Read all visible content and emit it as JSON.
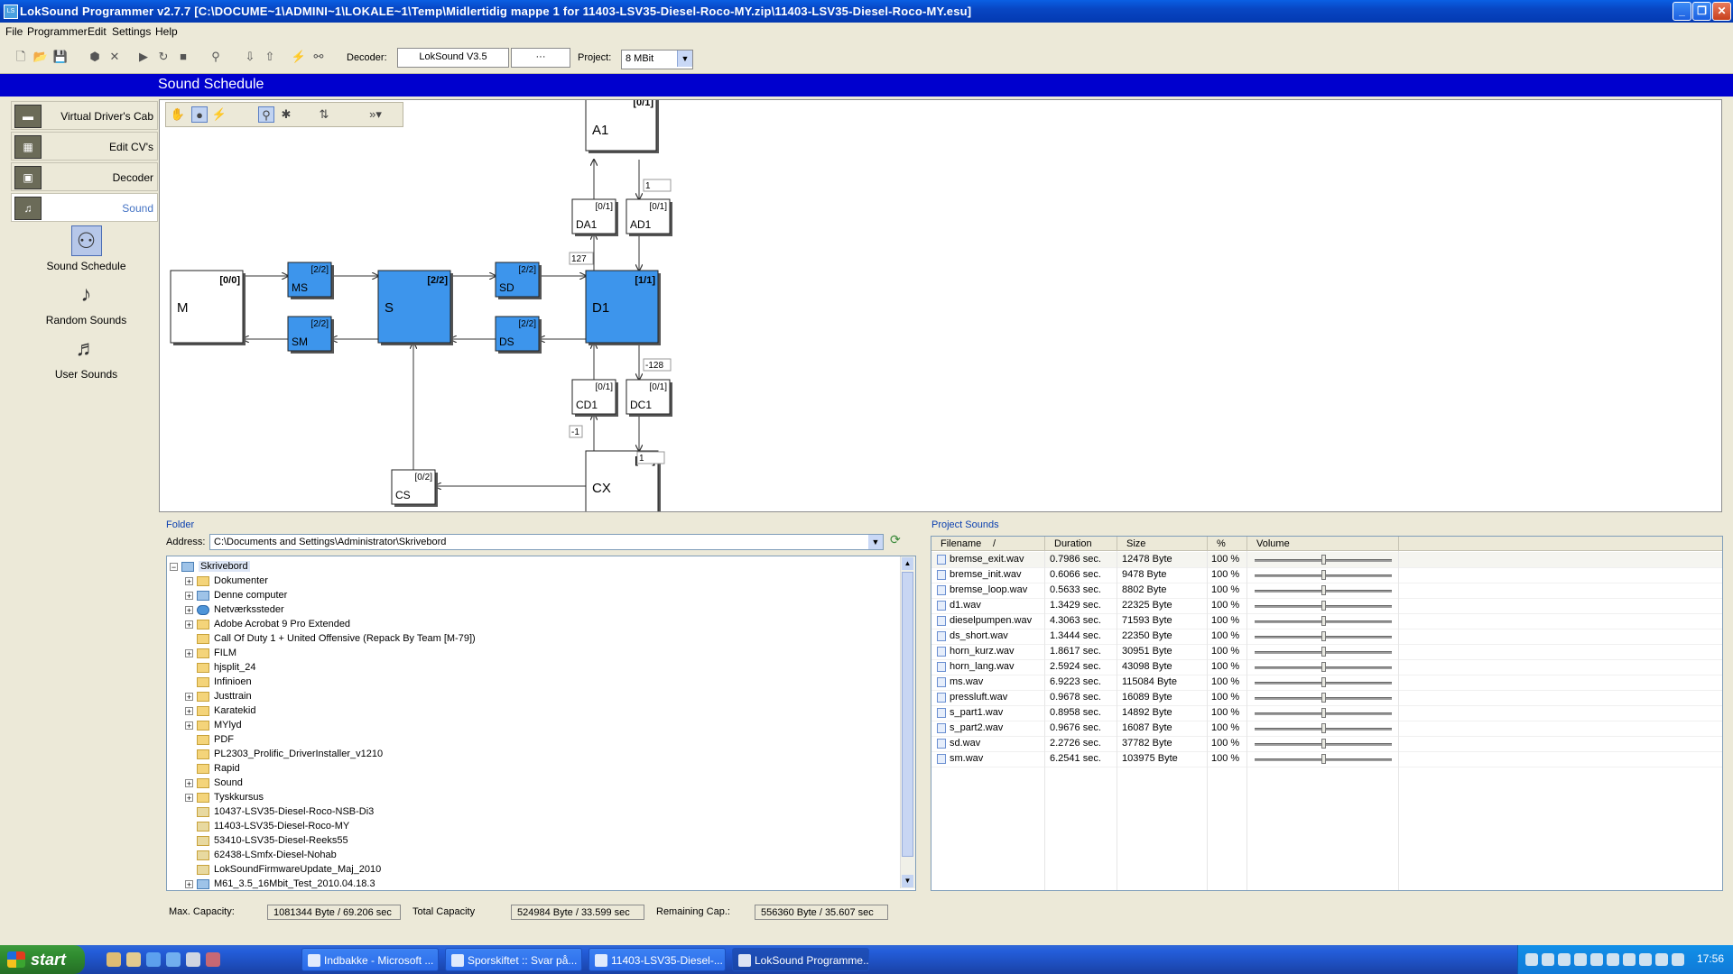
{
  "window": {
    "title": "LokSound Programmer  v2.7.7  [C:\\DOCUME~1\\ADMINI~1\\LOKALE~1\\Temp\\Midlertidig mappe 1 for 11403-LSV35-Diesel-Roco-MY.zip\\11403-LSV35-Diesel-Roco-MY.esu]",
    "icon_label": "LS"
  },
  "menu": [
    "File",
    "Programmer",
    "Edit",
    "Settings",
    "Help"
  ],
  "toolbar": {
    "decoder_label": "Decoder:",
    "decoder_value": "LokSound V3.5",
    "decoder_extra": "···",
    "project_label": "Project:",
    "project_value": "8 MBit"
  },
  "header": {
    "title": "Sound Schedule"
  },
  "leftnav": {
    "items": [
      {
        "label": "Virtual Driver's Cab"
      },
      {
        "label": "Edit CV's"
      },
      {
        "label": "Decoder"
      },
      {
        "label": "Sound"
      }
    ],
    "sub": [
      {
        "label": "Sound Schedule"
      },
      {
        "label": "Random Sounds"
      },
      {
        "label": "User Sounds"
      }
    ]
  },
  "diagram": {
    "nodes": [
      {
        "id": "A1",
        "label": "A1",
        "count": "[0/1]"
      },
      {
        "id": "DA1",
        "label": "DA1",
        "count": "[0/1]"
      },
      {
        "id": "AD1",
        "label": "AD1",
        "count": "[0/1]"
      },
      {
        "id": "M",
        "label": "M",
        "count": "[0/0]"
      },
      {
        "id": "MS",
        "label": "MS",
        "count": "[2/2]"
      },
      {
        "id": "SM",
        "label": "SM",
        "count": "[2/2]"
      },
      {
        "id": "S",
        "label": "S",
        "count": "[2/2]"
      },
      {
        "id": "SD",
        "label": "SD",
        "count": "[2/2]"
      },
      {
        "id": "DS",
        "label": "DS",
        "count": "[2/2]"
      },
      {
        "id": "D1",
        "label": "D1",
        "count": "[1/1]"
      },
      {
        "id": "CD1",
        "label": "CD1",
        "count": "[0/1]"
      },
      {
        "id": "DC1",
        "label": "DC1",
        "count": "[0/1]"
      },
      {
        "id": "CX",
        "label": "CX",
        "count": "[0/1]"
      },
      {
        "id": "CS",
        "label": "CS",
        "count": "[0/2]"
      }
    ],
    "edge_labels": [
      "1",
      "127",
      "-128",
      "-1",
      "1"
    ]
  },
  "folder": {
    "group_label": "Folder",
    "address_label": "Address:",
    "address_value": "C:\\Documents and Settings\\Administrator\\Skrivebord",
    "tree": [
      {
        "label": "Skrivebord",
        "type": "root",
        "exp": "−"
      },
      {
        "label": "Dokumenter",
        "type": "folder",
        "exp": "+"
      },
      {
        "label": "Denne computer",
        "type": "pc",
        "exp": "+"
      },
      {
        "label": "Netværkssteder",
        "type": "net",
        "exp": "+"
      },
      {
        "label": "Adobe Acrobat 9 Pro Extended",
        "type": "folder",
        "exp": "+"
      },
      {
        "label": "Call Of Duty 1 + United Offensive (Repack By Team [M-79])",
        "type": "folder",
        "exp": ""
      },
      {
        "label": "FILM",
        "type": "folder",
        "exp": "+"
      },
      {
        "label": "hjsplit_24",
        "type": "folder",
        "exp": ""
      },
      {
        "label": "Infinioen",
        "type": "folder",
        "exp": ""
      },
      {
        "label": "Justtrain",
        "type": "folder",
        "exp": "+"
      },
      {
        "label": "Karatekid",
        "type": "folder",
        "exp": "+"
      },
      {
        "label": "MYlyd",
        "type": "folder",
        "exp": "+"
      },
      {
        "label": "PDF",
        "type": "folder",
        "exp": ""
      },
      {
        "label": "PL2303_Prolific_DriverInstaller_v1210",
        "type": "folder",
        "exp": ""
      },
      {
        "label": "Rapid",
        "type": "folder",
        "exp": ""
      },
      {
        "label": "Sound",
        "type": "folder",
        "exp": "+"
      },
      {
        "label": "Tyskkursus",
        "type": "folder",
        "exp": "+"
      },
      {
        "label": "10437-LSV35-Diesel-Roco-NSB-Di3",
        "type": "zip",
        "exp": ""
      },
      {
        "label": "11403-LSV35-Diesel-Roco-MY",
        "type": "zip",
        "exp": ""
      },
      {
        "label": "53410-LSV35-Diesel-Reeks55",
        "type": "zip",
        "exp": ""
      },
      {
        "label": "62438-LSmfx-Diesel-Nohab",
        "type": "zip",
        "exp": ""
      },
      {
        "label": "LokSoundFirmwareUpdate_Maj_2010",
        "type": "zip",
        "exp": ""
      },
      {
        "label": "M61_3.5_16Mbit_Test_2010.04.18.3",
        "type": "pc",
        "exp": "+"
      }
    ]
  },
  "sounds": {
    "group_label": "Project Sounds",
    "columns": [
      "Filename",
      "Duration",
      "Size",
      "%",
      "Volume"
    ],
    "sort_indicator": "/",
    "rows": [
      {
        "file": "bremse_exit.wav",
        "duration": "0.7986 sec.",
        "size": "12478 Byte",
        "pct": "100 %"
      },
      {
        "file": "bremse_init.wav",
        "duration": "0.6066 sec.",
        "size": "9478 Byte",
        "pct": "100 %"
      },
      {
        "file": "bremse_loop.wav",
        "duration": "0.5633 sec.",
        "size": "8802 Byte",
        "pct": "100 %"
      },
      {
        "file": "d1.wav",
        "duration": "1.3429 sec.",
        "size": "22325 Byte",
        "pct": "100 %"
      },
      {
        "file": "dieselpumpen.wav",
        "duration": "4.3063 sec.",
        "size": "71593 Byte",
        "pct": "100 %"
      },
      {
        "file": "ds_short.wav",
        "duration": "1.3444 sec.",
        "size": "22350 Byte",
        "pct": "100 %"
      },
      {
        "file": "horn_kurz.wav",
        "duration": "1.8617 sec.",
        "size": "30951 Byte",
        "pct": "100 %"
      },
      {
        "file": "horn_lang.wav",
        "duration": "2.5924 sec.",
        "size": "43098 Byte",
        "pct": "100 %"
      },
      {
        "file": "ms.wav",
        "duration": "6.9223 sec.",
        "size": "115084 Byte",
        "pct": "100 %"
      },
      {
        "file": "pressluft.wav",
        "duration": "0.9678 sec.",
        "size": "16089 Byte",
        "pct": "100 %"
      },
      {
        "file": "s_part1.wav",
        "duration": "0.8958 sec.",
        "size": "14892 Byte",
        "pct": "100 %"
      },
      {
        "file": "s_part2.wav",
        "duration": "0.9676 sec.",
        "size": "16087 Byte",
        "pct": "100 %"
      },
      {
        "file": "sd.wav",
        "duration": "2.2726 sec.",
        "size": "37782 Byte",
        "pct": "100 %"
      },
      {
        "file": "sm.wav",
        "duration": "6.2541 sec.",
        "size": "103975 Byte",
        "pct": "100 %"
      }
    ],
    "volume_level": 0.5
  },
  "status": {
    "max_label": "Max. Capacity:",
    "max_value": "1081344 Byte / 69.206 sec",
    "total_label": "Total Capacity",
    "total_value": "524984 Byte / 33.599 sec",
    "remaining_label": "Remaining Cap.:",
    "remaining_value": "556360 Byte / 35.607 sec"
  },
  "taskbar": {
    "start_label": "start",
    "tasks": [
      {
        "label": "Indbakke - Microsoft ..."
      },
      {
        "label": "Sporskiftet :: Svar på..."
      },
      {
        "label": "11403-LSV35-Diesel-..."
      },
      {
        "label": "LokSound Programme..."
      }
    ],
    "clock": "17:56"
  },
  "colors": {
    "title_blue": "#0846c3",
    "header_blue": "#0000ce",
    "node_blue": "#3d95ec",
    "accent": "#4473c4"
  }
}
